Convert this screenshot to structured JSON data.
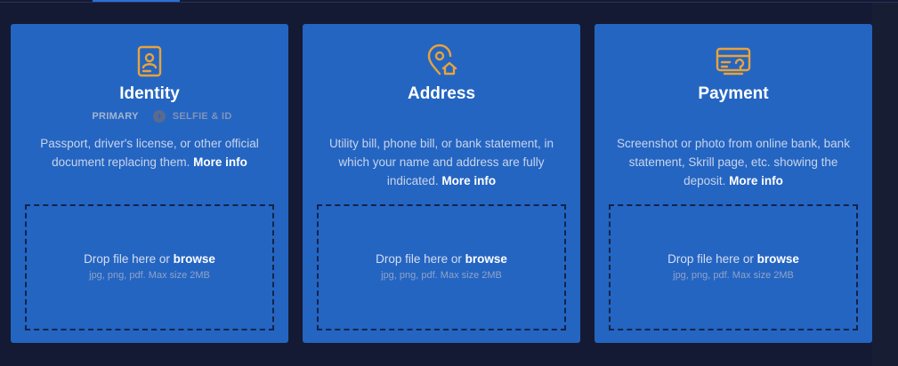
{
  "colors": {
    "background": "#141a33",
    "card": "#2465c2",
    "icon": "#e8a33a",
    "accent": "#2a6fdb"
  },
  "cards": [
    {
      "title": "Identity",
      "icon": "id-card-icon",
      "steps": {
        "primary": "PRIMARY",
        "secondary": "SELFIE & ID"
      },
      "description": "Passport, driver's license, or other official document replacing them.",
      "more_info": "More info",
      "drop_text": "Drop file here or",
      "browse": "browse",
      "hint": "jpg, png, pdf. Max size 2MB"
    },
    {
      "title": "Address",
      "icon": "location-home-icon",
      "description": "Utility bill, phone bill, or bank statement, in which your name and address are fully indicated.",
      "more_info": "More info",
      "drop_text": "Drop file here or",
      "browse": "browse",
      "hint": "jpg, png, pdf. Max size 2MB"
    },
    {
      "title": "Payment",
      "icon": "payment-card-icon",
      "description": "Screenshot or photo from online bank, bank statement, Skrill page, etc. showing the deposit.",
      "more_info": "More info",
      "drop_text": "Drop file here or",
      "browse": "browse",
      "hint": "jpg, png, pdf. Max size 2MB"
    }
  ]
}
